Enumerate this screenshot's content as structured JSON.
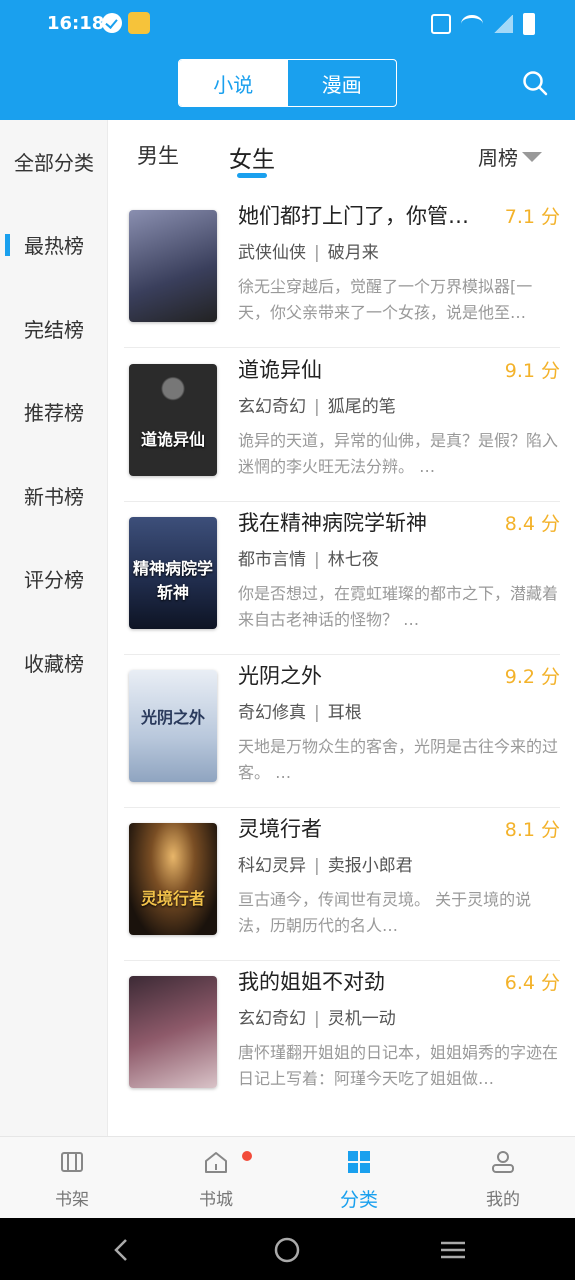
{
  "status_bar": {
    "time": "16:18"
  },
  "header": {
    "segments": [
      {
        "label": "小说",
        "active": true
      },
      {
        "label": "漫画",
        "active": false
      }
    ],
    "search_icon": "search-icon"
  },
  "sidebar": {
    "items": [
      {
        "label": "全部分类",
        "active": false
      },
      {
        "label": "最热榜",
        "active": true
      },
      {
        "label": "完结榜",
        "active": false
      },
      {
        "label": "推荐榜",
        "active": false
      },
      {
        "label": "新书榜",
        "active": false
      },
      {
        "label": "评分榜",
        "active": false
      },
      {
        "label": "收藏榜",
        "active": false
      }
    ]
  },
  "gender_tabs": [
    {
      "label": "男生",
      "active": false
    },
    {
      "label": "女生",
      "active": true
    }
  ],
  "rank_period": "周榜",
  "books": [
    {
      "title": "她们都打上门了，你管这叫模拟器",
      "display_title": "她们都打上门了，你管…",
      "score": "7.1 分",
      "genre": "武侠仙侠",
      "author": "破月来",
      "desc": "徐无尘穿越后，觉醒了一个万界模拟器[一天，你父亲带来了一个女孩，说是他至…",
      "cover_color": "#5a5f7c"
    },
    {
      "title": "道诡异仙",
      "display_title": "道诡异仙",
      "score": "9.1 分",
      "genre": "玄幻奇幻",
      "author": "狐尾的笔",
      "desc": "诡异的天道，异常的仙佛，是真？是假？陷入迷惘的李火旺无法分辨。 …",
      "cover_color": "#2b2b2b",
      "cover_text": "道诡异仙"
    },
    {
      "title": "我在精神病院学斩神",
      "display_title": "我在精神病院学斩神",
      "score": "8.4 分",
      "genre": "都市言情",
      "author": "林七夜",
      "desc": "你是否想过，在霓虹璀璨的都市之下，潜藏着来自古老神话的怪物？ …",
      "cover_color": "#1f2b4a",
      "cover_text": "精神病院学斩神"
    },
    {
      "title": "光阴之外",
      "display_title": "光阴之外",
      "score": "9.2 分",
      "genre": "奇幻修真",
      "author": "耳根",
      "desc": "天地是万物众生的客舍，光阴是古往今来的过客。 …",
      "cover_color": "#c9d6e6",
      "cover_text": "光阴之外"
    },
    {
      "title": "灵境行者",
      "display_title": "灵境行者",
      "score": "8.1 分",
      "genre": "科幻灵异",
      "author": "卖报小郎君",
      "desc": "亘古通今，传闻世有灵境。 关于灵境的说法，历朝历代的名人…",
      "cover_color": "#3a2a1c",
      "cover_text": "灵境行者"
    },
    {
      "title": "我的姐姐不对劲",
      "display_title": "我的姐姐不对劲",
      "score": "6.4 分",
      "genre": "玄幻奇幻",
      "author": "灵机一动",
      "desc": "唐怀瑾翻开姐姐的日记本，姐姐娟秀的字迹在日记上写着：阿瑾今天吃了姐姐做…",
      "cover_color": "#5a3d4a"
    }
  ],
  "bottom_nav": [
    {
      "label": "书架",
      "icon": "bookshelf-icon",
      "active": false
    },
    {
      "label": "书城",
      "icon": "home-icon",
      "active": false,
      "badge": true
    },
    {
      "label": "分类",
      "icon": "category-icon",
      "active": true
    },
    {
      "label": "我的",
      "icon": "profile-icon",
      "active": false
    }
  ],
  "colors": {
    "primary": "#1aa0ee",
    "score": "#f3b22a",
    "badge": "#f24b3a"
  }
}
